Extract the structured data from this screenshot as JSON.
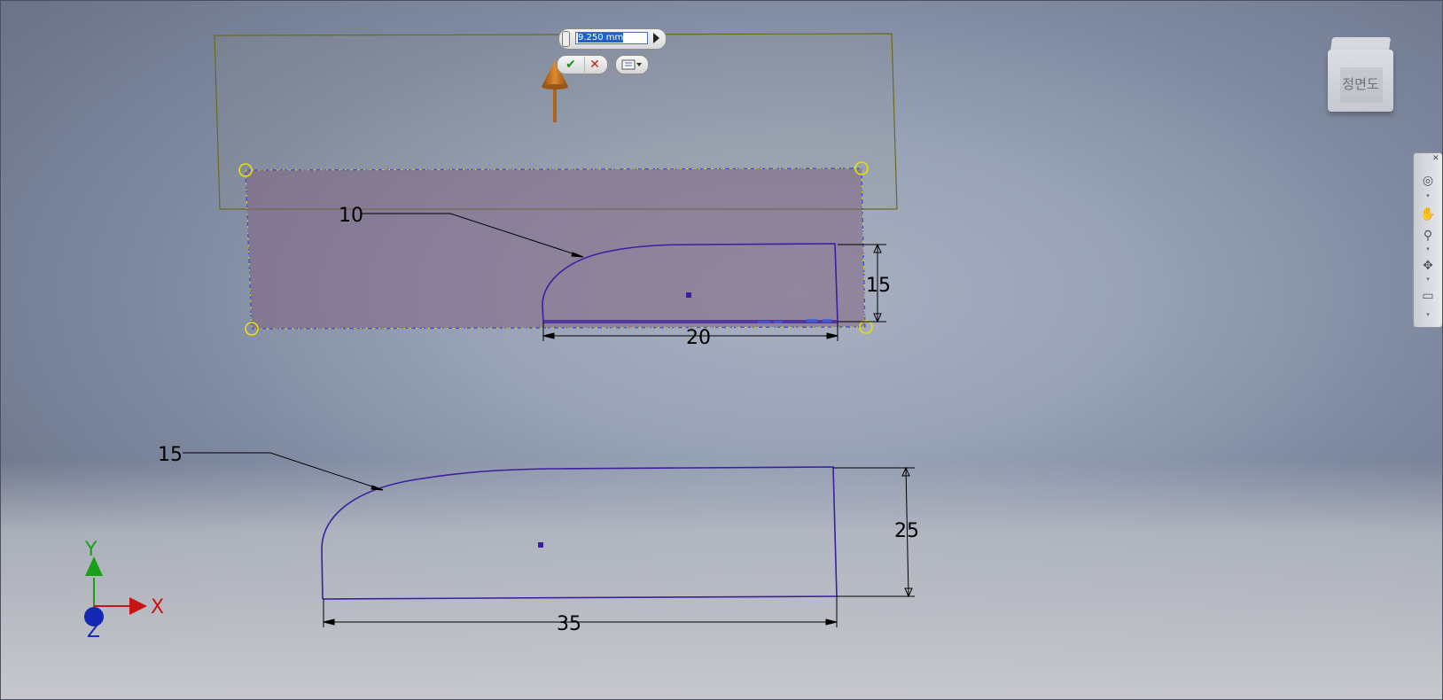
{
  "extrude": {
    "distance_value": "9.250 mm",
    "ok_icon": "checkmark-icon",
    "cancel_icon": "close-icon",
    "options_icon": "list-options-icon"
  },
  "view_cube": {
    "face_label": "정면도"
  },
  "nav_bar": {
    "icons": [
      "steering-wheel-icon",
      "pan-hand-icon",
      "zoom-icon",
      "orbit-icon",
      "look-at-icon"
    ]
  },
  "profile_upper": {
    "radius_dim": "10",
    "height_dim": "15",
    "width_dim": "20"
  },
  "profile_lower": {
    "radius_dim": "15",
    "height_dim": "25",
    "width_dim": "35"
  },
  "axes": {
    "x_label": "X",
    "y_label": "Y",
    "z_label": "Z"
  },
  "colors": {
    "sketch_line": "#3b1fa0",
    "selection": "#e8e000",
    "direction_arrow": "#c8701a",
    "x_axis": "#c81414",
    "y_axis": "#18a018",
    "z_axis": "#1428b4"
  }
}
